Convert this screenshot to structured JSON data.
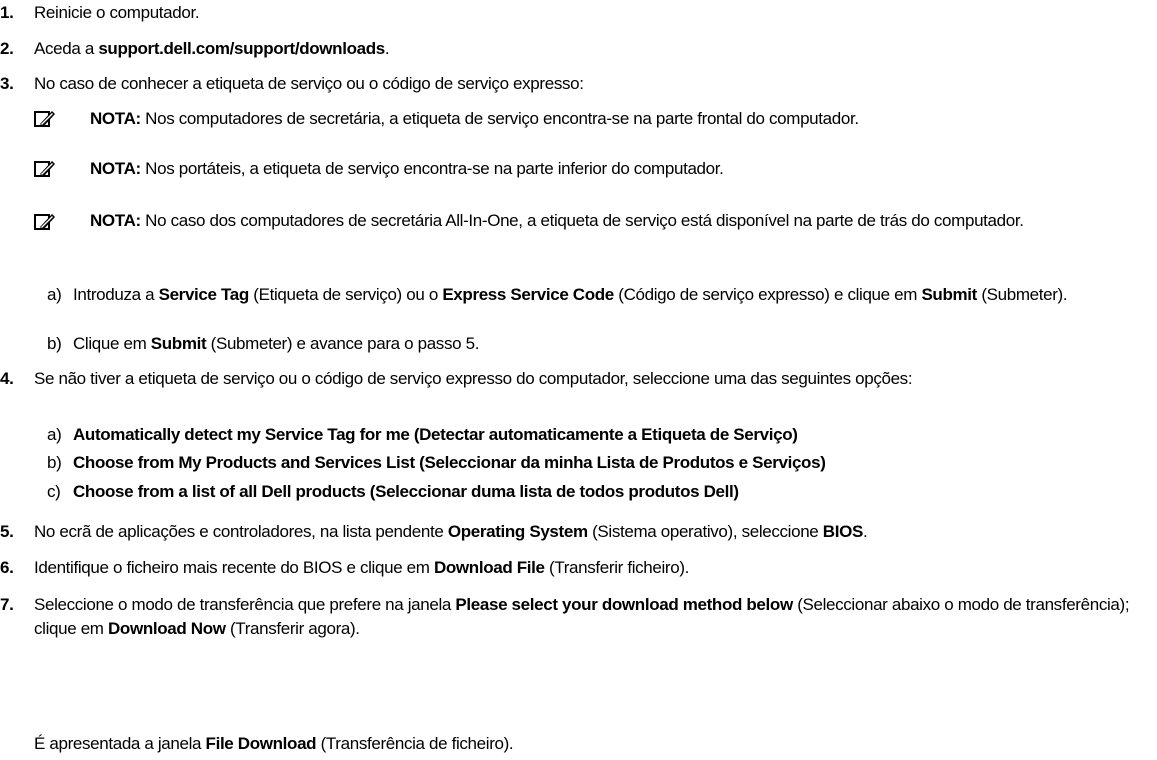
{
  "steps": [
    {
      "num": "1.",
      "parts": [
        {
          "t": "Reinicie o computador."
        }
      ]
    },
    {
      "num": "2.",
      "parts": [
        {
          "t": "Aceda a "
        },
        {
          "t": "support.dell.com/support/downloads",
          "b": true
        },
        {
          "t": "."
        }
      ]
    },
    {
      "num": "3.",
      "parts": [
        {
          "t": "No caso de conhecer a etiqueta de serviço ou o código de serviço expresso:"
        }
      ]
    },
    {
      "num": "4.",
      "parts": [
        {
          "t": "Se não tiver a etiqueta de serviço ou o código de serviço expresso do computador, seleccione uma das seguintes opções:"
        }
      ]
    },
    {
      "num": "5.",
      "parts": [
        {
          "t": "No ecrã de aplicações e controladores, na lista pendente "
        },
        {
          "t": "Operating System",
          "b": true
        },
        {
          "t": " (Sistema operativo), seleccione "
        },
        {
          "t": "BIOS",
          "b": true
        },
        {
          "t": "."
        }
      ]
    },
    {
      "num": "6.",
      "parts": [
        {
          "t": "Identifique o ficheiro mais recente do BIOS e clique em "
        },
        {
          "t": "Download File",
          "b": true
        },
        {
          "t": " (Transferir ficheiro)."
        }
      ]
    },
    {
      "num": "7.",
      "parts": [
        {
          "t": "Seleccione o modo de transferência que prefere na janela "
        },
        {
          "t": "Please select your download method below",
          "b": true
        },
        {
          "t": " (Seleccionar abaixo o modo de transferência); clique em "
        },
        {
          "t": "Download Now",
          "b": true
        },
        {
          "t": " (Transferir agora)."
        }
      ]
    }
  ],
  "notes": [
    {
      "label": "NOTA:",
      "text": " Nos computadores de secretária, a etiqueta de serviço encontra-se na parte frontal do computador."
    },
    {
      "label": "NOTA:",
      "text": " Nos portáteis, a etiqueta de serviço encontra-se na parte inferior do computador."
    },
    {
      "label": "NOTA:",
      "text": " No caso dos computadores de secretária All-In-One, a etiqueta de serviço está disponível na parte de trás do computador."
    }
  ],
  "step3_subs": [
    {
      "label": "a)",
      "parts": [
        {
          "t": "Introduza a "
        },
        {
          "t": "Service Tag",
          "b": true
        },
        {
          "t": " (Etiqueta de serviço) ou o "
        },
        {
          "t": "Express Service Code",
          "b": true
        },
        {
          "t": " (Código de serviço expresso) e clique em "
        },
        {
          "t": "Submit",
          "b": true
        },
        {
          "t": " (Submeter)."
        }
      ]
    },
    {
      "label": "b)",
      "parts": [
        {
          "t": "Clique em "
        },
        {
          "t": "Submit",
          "b": true
        },
        {
          "t": " (Submeter) e avance para o passo 5."
        }
      ]
    }
  ],
  "step4_subs": [
    {
      "label": "a)",
      "parts": [
        {
          "t": "Automatically detect my Service Tag for me (Detectar automaticamente a Etiqueta de Serviço)",
          "b": true
        }
      ]
    },
    {
      "label": "b)",
      "parts": [
        {
          "t": "Choose from My Products and Services List (Seleccionar da minha Lista de Produtos e Serviços)",
          "b": true
        }
      ]
    },
    {
      "label": "c)",
      "parts": [
        {
          "t": "Choose from a list of all Dell products (Seleccionar duma lista de todos produtos Dell)",
          "b": true
        }
      ]
    }
  ],
  "final_line": [
    {
      "t": "É apresentada a janela "
    },
    {
      "t": "File Download",
      "b": true
    },
    {
      "t": " (Transferência de ficheiro)."
    }
  ],
  "icon": "note-pencil-icon"
}
